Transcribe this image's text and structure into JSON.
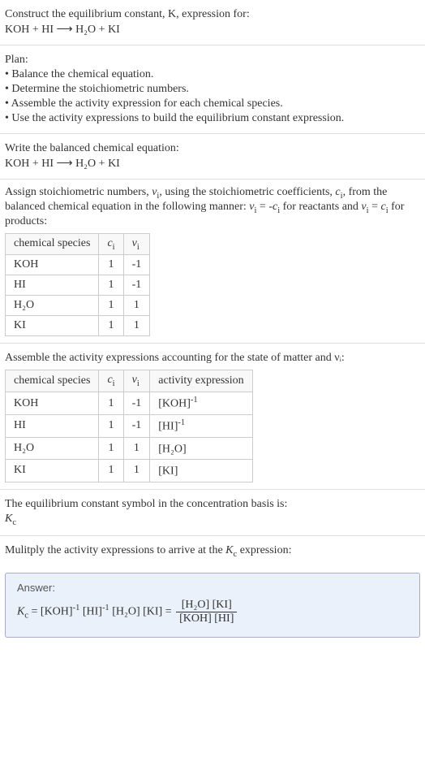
{
  "intro": {
    "line1": "Construct the equilibrium constant, K, expression for:",
    "equation": "KOH + HI ⟶ H₂O + KI"
  },
  "plan": {
    "heading": "Plan:",
    "item1": "• Balance the chemical equation.",
    "item2": "• Determine the stoichiometric numbers.",
    "item3": "• Assemble the activity expression for each chemical species.",
    "item4": "• Use the activity expressions to build the equilibrium constant expression."
  },
  "balanced": {
    "heading": "Write the balanced chemical equation:",
    "equation": "KOH + HI ⟶ H₂O + KI"
  },
  "stoich": {
    "intro_part1": "Assign stoichiometric numbers, ",
    "intro_part2": ", using the stoichiometric coefficients, ",
    "intro_part3": ", from the balanced chemical equation in the following manner: ",
    "intro_part4": " for reactants and ",
    "intro_part5": " for products:",
    "table": {
      "head_species": "chemical species",
      "head_ci": "cᵢ",
      "head_vi": "νᵢ",
      "rows": [
        {
          "species": "KOH",
          "ci": "1",
          "vi": "-1"
        },
        {
          "species": "HI",
          "ci": "1",
          "vi": "-1"
        },
        {
          "species": "H₂O",
          "ci": "1",
          "vi": "1"
        },
        {
          "species": "KI",
          "ci": "1",
          "vi": "1"
        }
      ]
    }
  },
  "activity": {
    "intro": "Assemble the activity expressions accounting for the state of matter and νᵢ:",
    "table": {
      "head_species": "chemical species",
      "head_ci": "cᵢ",
      "head_vi": "νᵢ",
      "head_act": "activity expression",
      "rows": [
        {
          "species": "KOH",
          "ci": "1",
          "vi": "-1",
          "act_base": "[KOH]",
          "act_exp": "-1"
        },
        {
          "species": "HI",
          "ci": "1",
          "vi": "-1",
          "act_base": "[HI]",
          "act_exp": "-1"
        },
        {
          "species": "H₂O",
          "ci": "1",
          "vi": "1",
          "act_base": "[H₂O]",
          "act_exp": ""
        },
        {
          "species": "KI",
          "ci": "1",
          "vi": "1",
          "act_base": "[KI]",
          "act_exp": ""
        }
      ]
    }
  },
  "symbol": {
    "line1": "The equilibrium constant symbol in the concentration basis is:",
    "line2": "K꜀"
  },
  "final": {
    "intro": "Mulitply the activity expressions to arrive at the K꜀ expression:",
    "answer_label": "Answer:",
    "expr_lhs": "K꜀ = [KOH]",
    "expr_e1": "-1",
    "expr_mid1": " [HI]",
    "expr_e2": "-1",
    "expr_mid2": " [H₂O] [KI] = ",
    "frac_num": "[H₂O] [KI]",
    "frac_den": "[KOH] [HI]"
  }
}
